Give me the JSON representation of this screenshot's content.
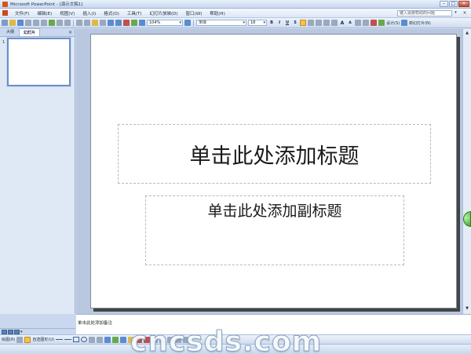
{
  "window": {
    "title": "Microsoft PowerPoint - [演示文稿1]",
    "buttons": {
      "minimize": "–",
      "maximize": "□",
      "close": "✕"
    }
  },
  "menubar": {
    "items": [
      "文件(F)",
      "编辑(E)",
      "视图(V)",
      "插入(I)",
      "格式(O)",
      "工具(T)",
      "幻灯片放映(D)",
      "窗口(W)",
      "帮助(H)"
    ],
    "help_placeholder": "键入需要帮助的问题",
    "help_arrow": "▾",
    "close": "×"
  },
  "toolbar": {
    "zoom": "104%",
    "font_name": "宋体",
    "font_size": "18",
    "bold": "B",
    "italic": "I",
    "underline": "U",
    "shadow": "S",
    "grow_font": "A",
    "shrink_font": "A",
    "design_label": "设计(S)",
    "new_slide_label": "新幻灯片(N)"
  },
  "left_pane": {
    "tabs": [
      "大纲",
      "幻灯片"
    ],
    "active_tab": 1,
    "close": "×",
    "slides": [
      {
        "number": "1"
      }
    ]
  },
  "slide": {
    "title_placeholder": "单击此处添加标题",
    "subtitle_placeholder": "单击此处添加副标题"
  },
  "notes": {
    "placeholder": "单击此处添加备注"
  },
  "drawbar": {
    "draw_label": "绘图(R)",
    "autoshapes_label": "自选图形(U)"
  },
  "scrollbar": {
    "up": "▲",
    "down": "▼"
  },
  "watermark": "cncsds.com",
  "colors": {
    "titlebar": "#c7d8ee",
    "accent": "#6b8fc7",
    "workspace": "#b9c8df",
    "slide_bg": "#ffffff"
  }
}
